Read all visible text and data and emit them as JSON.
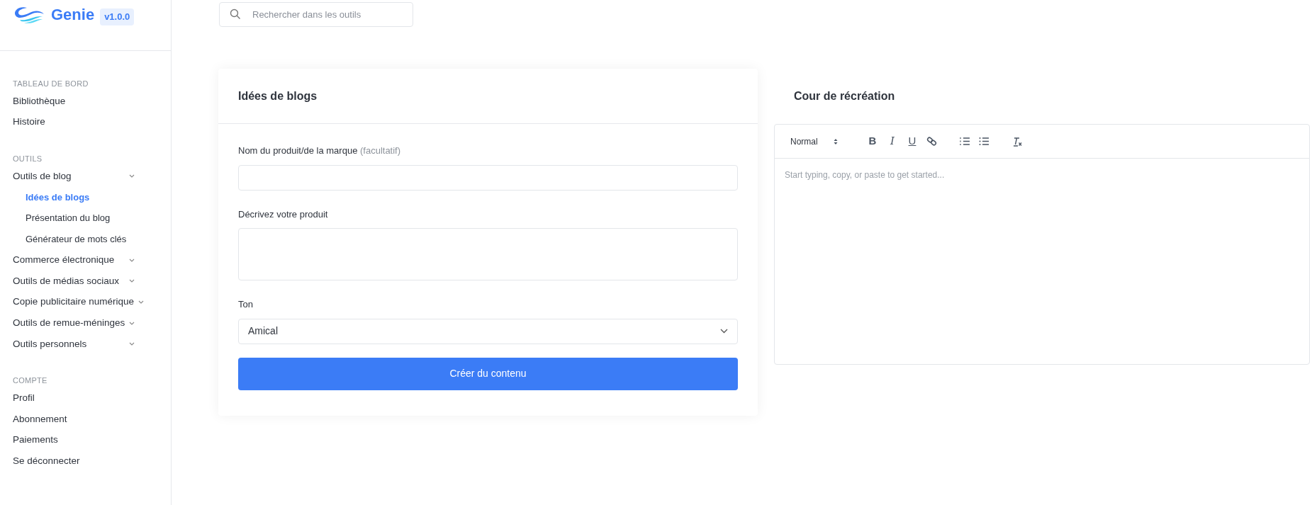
{
  "brand": {
    "name": "Genie",
    "version": "v1.0.0"
  },
  "search": {
    "placeholder": "Rechercher dans les outils"
  },
  "sidebar": {
    "sections": [
      {
        "title": "TABLEAU DE BORD",
        "items": [
          {
            "label": "Bibliothèque",
            "selected": false
          },
          {
            "label": "Histoire",
            "selected": false
          }
        ]
      },
      {
        "title": "OUTILS",
        "items": [
          {
            "kind": "group",
            "label": "Outils de blog",
            "selected": false,
            "children": [
              {
                "label": "Idées de blogs",
                "selected": true
              },
              {
                "label": "Présentation du blog",
                "selected": false
              },
              {
                "label": "Générateur de mots clés",
                "selected": false
              }
            ]
          },
          {
            "kind": "group",
            "label": "Commerce électronique",
            "selected": false
          },
          {
            "kind": "group",
            "label": "Outils de médias sociaux",
            "selected": false
          },
          {
            "kind": "group",
            "label": "Copie publicitaire numérique",
            "selected": false
          },
          {
            "kind": "group",
            "label": "Outils de remue-méninges",
            "selected": false
          },
          {
            "kind": "group",
            "label": "Outils personnels",
            "selected": false
          }
        ]
      },
      {
        "title": "COMPTE",
        "items": [
          {
            "label": "Profil",
            "selected": false
          },
          {
            "label": "Abonnement",
            "selected": false
          },
          {
            "label": "Paiements",
            "selected": false
          },
          {
            "label": "Se déconnecter",
            "selected": false
          }
        ]
      }
    ]
  },
  "form": {
    "title": "Idées de blogs",
    "fields": [
      {
        "kind": "input",
        "label": "Nom du produit/de la marque",
        "hint": "(facultatif)"
      },
      {
        "kind": "textarea",
        "label": "Décrivez votre produit"
      },
      {
        "kind": "select",
        "label": "Ton",
        "value": "Amical"
      }
    ],
    "submit": "Créer du contenu"
  },
  "editor": {
    "title": "Cour de récréation",
    "toolbar": [
      {
        "kind": "dropdown",
        "label": "Normal"
      },
      {
        "kind": "bold",
        "label": "B"
      },
      {
        "kind": "italic",
        "label": "I"
      },
      {
        "kind": "underline",
        "label": "U"
      },
      {
        "kind": "link"
      },
      {
        "kind": "gap"
      },
      {
        "kind": "ordered-list"
      },
      {
        "kind": "bullet-list"
      },
      {
        "kind": "gap"
      },
      {
        "kind": "clear"
      }
    ],
    "placeholder": "Start typing, copy, or paste to get started..."
  }
}
